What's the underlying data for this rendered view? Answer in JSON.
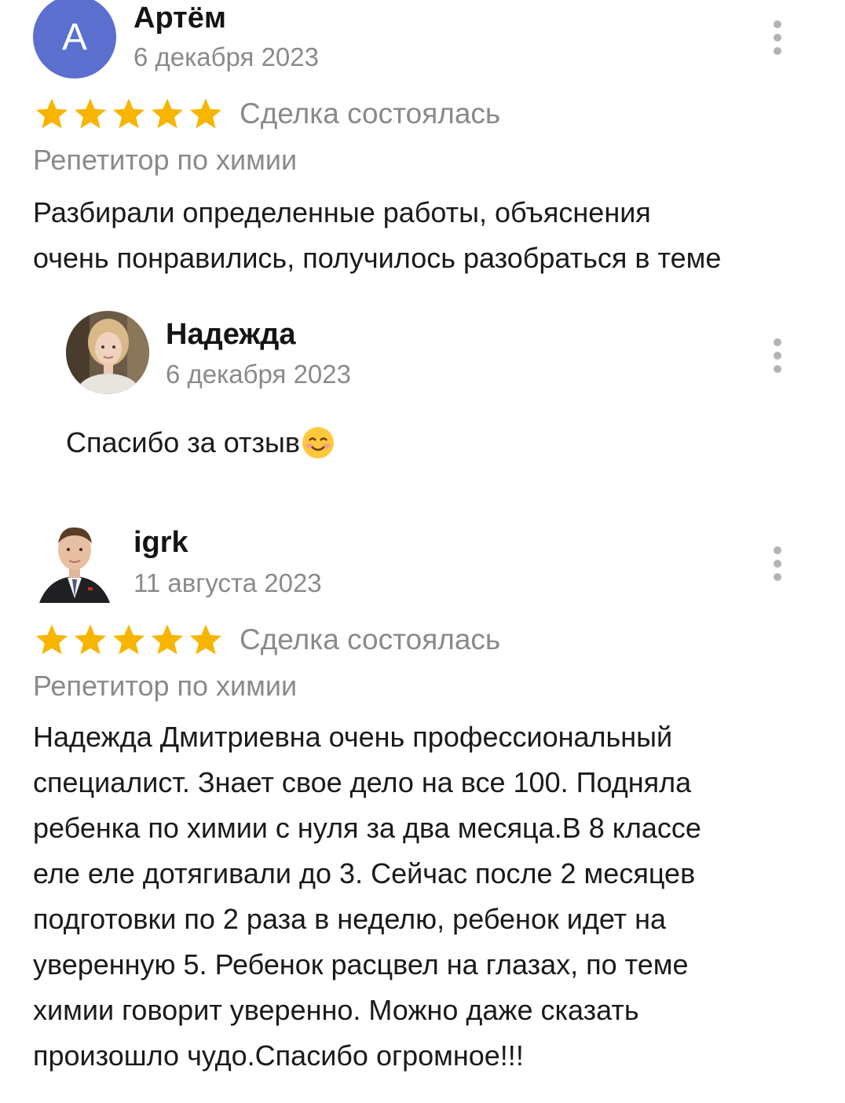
{
  "reviews": [
    {
      "avatar_letter": "А",
      "avatar_color": "#5b6fcf",
      "author": "Артём",
      "date": "6 декабря 2023",
      "rating": 5,
      "deal_status": "Сделка состоялась",
      "service": "Репетитор по химии",
      "text_lines": [
        "Разбирали определенные работы, объяснения",
        "очень понравились, получилось разобраться в теме"
      ],
      "reply": {
        "author": "Надежда",
        "date": "6 декабря 2023",
        "text": "Спасибо за отзыв",
        "emoji": "smiling-face-emoji"
      }
    },
    {
      "author": "igrk",
      "date": "11 августа 2023",
      "rating": 5,
      "deal_status": "Сделка состоялась",
      "service": "Репетитор по химии",
      "text_lines": [
        "Надежда Дмитриевна очень профессиональный",
        "специалист. Знает свое дело на все 100. Подняла",
        "ребенка по химии с нуля за два месяца.В 8 классе",
        "еле еле дотягивали до 3. Сейчас после 2 месяцев",
        "подготовки по 2 раза в неделю, ребенок идет на",
        "уверенную 5. Ребенок расцвел на глазах, по теме",
        "химии говорит уверенно. Можно даже сказать",
        "произошло чудо.Спасибо огромное!!!"
      ]
    }
  ],
  "colors": {
    "star": "#f7b500",
    "muted_text": "#8a8a8a",
    "kebab": "#b3b3b3"
  }
}
